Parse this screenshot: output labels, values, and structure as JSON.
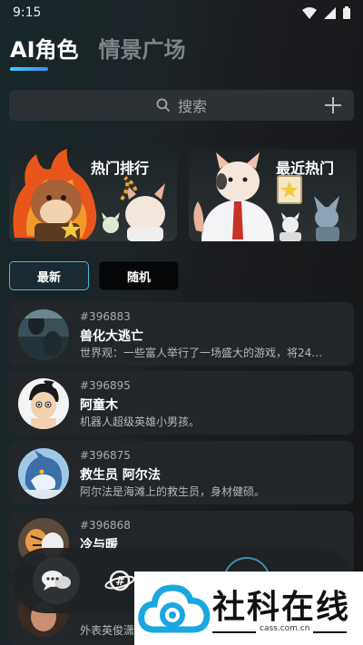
{
  "status_bar": {
    "time": "9:15"
  },
  "header": {
    "tabs": [
      {
        "label": "AI角色",
        "active": true
      },
      {
        "label": "情景广场",
        "active": false
      }
    ]
  },
  "search": {
    "placeholder": "搜索",
    "add_icon": "plus-icon"
  },
  "banners": [
    {
      "label": "热门排行"
    },
    {
      "label": "最近热门"
    }
  ],
  "filters": [
    {
      "label": "最新",
      "active": true
    },
    {
      "label": "随机",
      "active": false
    }
  ],
  "characters": [
    {
      "id": "#396883",
      "name": "兽化大逃亡",
      "desc": "世界观：一些富人举行了一场盛大的游戏，将24…"
    },
    {
      "id": "#396895",
      "name": "阿童木",
      "desc": "机器人超级英雄小男孩。"
    },
    {
      "id": "#396875",
      "name": "救生员 阿尔法",
      "desc": "阿尔法是海滩上的救生员，身材健硕。"
    },
    {
      "id": "#396868",
      "name": "冷与暖",
      "desc": ""
    },
    {
      "id": "",
      "name": "",
      "desc": "外表英俊潇"
    }
  ],
  "bottom_nav": {
    "icons": [
      "chat-bubbles-icon",
      "planet-hash-icon"
    ]
  },
  "watermark": {
    "title": "社科在线",
    "url": "cass.com.cn"
  },
  "colors": {
    "accent": "#3fc8ff",
    "card_bg": "#232628",
    "page_bg": "#1b1e20"
  }
}
